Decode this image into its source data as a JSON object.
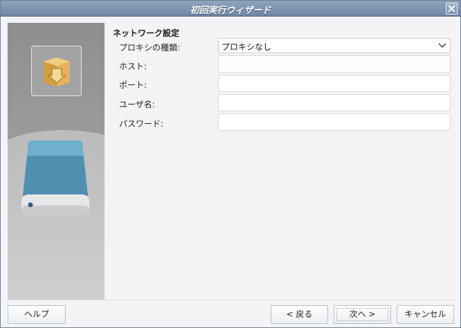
{
  "window": {
    "title": "初回実行ウィザード"
  },
  "sidebar": {
    "icons": [
      "package-download-icon",
      "hard-drive-icon"
    ]
  },
  "network": {
    "section_title": "ネットワーク設定",
    "proxy_type_label": "プロキシの種類:",
    "proxy_type_value": "プロキシなし",
    "host_label": "ホスト:",
    "host_value": "",
    "port_label": "ポート:",
    "port_value": "",
    "username_label": "ユーザ名:",
    "username_value": "",
    "password_label": "パスワード:",
    "password_value": ""
  },
  "buttons": {
    "help": "ヘルプ",
    "back": "< 戻る",
    "next": "次へ >",
    "cancel": "キャンセル"
  },
  "colors": {
    "titlebar": "#7890ac",
    "drive_body": "#4f8fb0"
  }
}
